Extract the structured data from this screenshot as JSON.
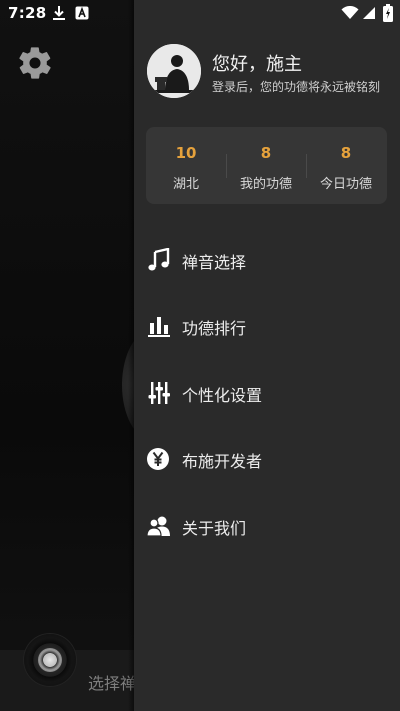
{
  "status_bar": {
    "time": "7:28"
  },
  "background": {
    "bottom_text": "选择禅"
  },
  "drawer": {
    "greeting": "您好，施主",
    "login_hint": "登录后，您的功德将永远被铭刻",
    "stats": [
      {
        "value": "10",
        "label": "湖北"
      },
      {
        "value": "8",
        "label": "我的功德"
      },
      {
        "value": "8",
        "label": "今日功德"
      }
    ],
    "menu": [
      {
        "label": "禅音选择",
        "icon": "music-note-icon"
      },
      {
        "label": "功德排行",
        "icon": "bar-chart-icon"
      },
      {
        "label": "个性化设置",
        "icon": "sliders-icon"
      },
      {
        "label": "布施开发者",
        "icon": "yen-coin-icon"
      },
      {
        "label": "关于我们",
        "icon": "users-icon"
      }
    ]
  },
  "colors": {
    "accent": "#e6a23c",
    "drawer_bg": "#2a2a2a",
    "card_bg": "#363636"
  }
}
